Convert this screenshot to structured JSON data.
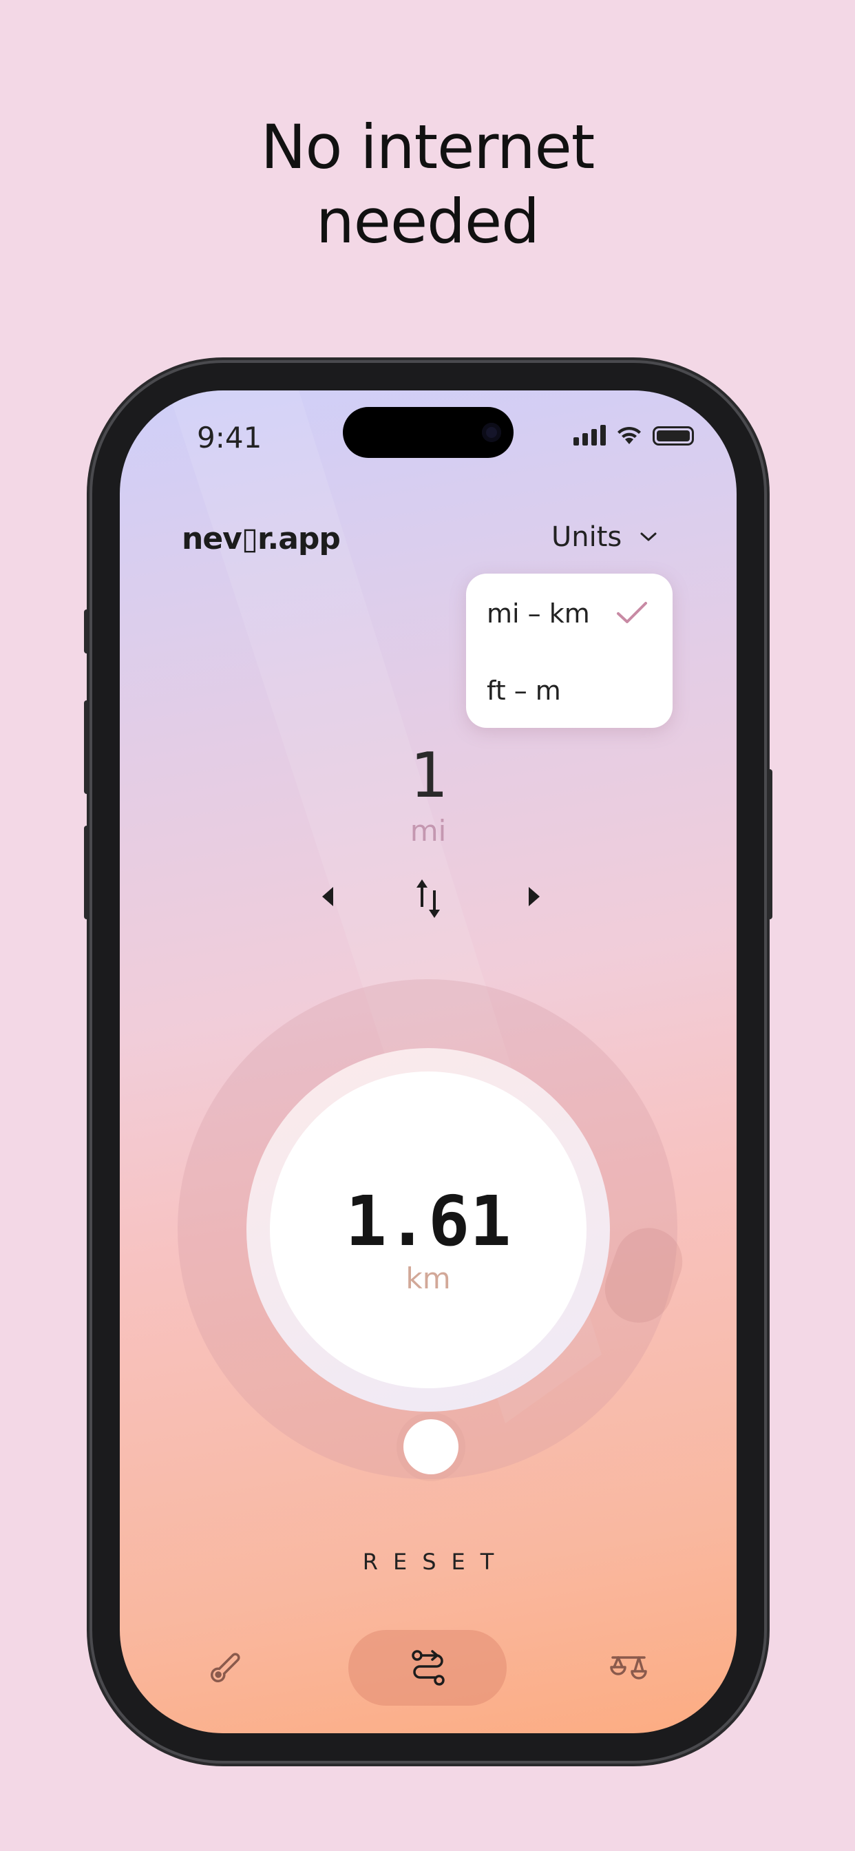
{
  "headline": {
    "line1": "No internet",
    "line2": "needed"
  },
  "status_bar": {
    "time": "9:41",
    "icons": [
      "signal-icon",
      "wifi-icon",
      "battery-icon"
    ]
  },
  "app": {
    "logo": "nev▯r.app"
  },
  "units_menu": {
    "label": "Units",
    "options": [
      {
        "label": "mi – km",
        "selected": true
      },
      {
        "label": "ft – m",
        "selected": false
      }
    ]
  },
  "converter": {
    "from_value": "1",
    "from_unit": "mi",
    "to_value": "1.61",
    "to_unit": "km",
    "reset_label": "RESET"
  },
  "bottom_nav": {
    "items": [
      {
        "icon": "thermometer-icon",
        "active": false
      },
      {
        "icon": "route-icon",
        "active": true
      },
      {
        "icon": "scale-icon",
        "active": false
      }
    ]
  },
  "colors": {
    "page_background": "#f3d8e6",
    "accent_pink": "#c497b0",
    "accent_peach": "#fcac82"
  }
}
